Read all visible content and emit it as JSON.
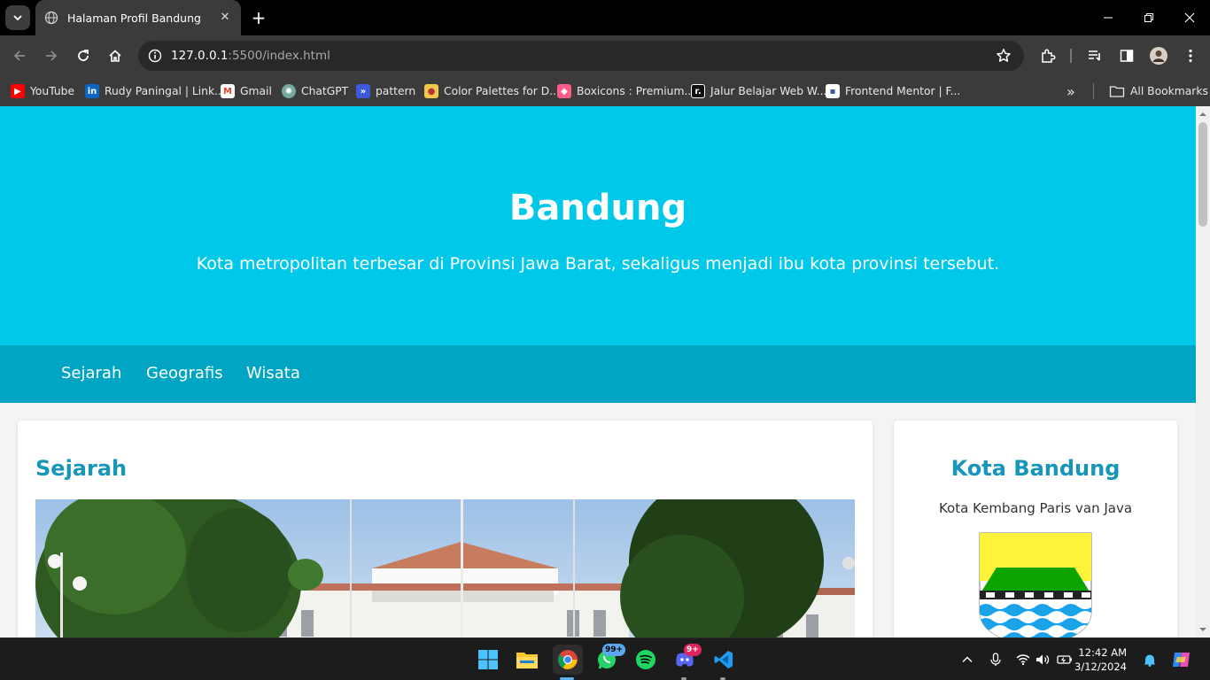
{
  "browser": {
    "tab_title": "Halaman Profil Bandung",
    "url_host": "127.0.0.1",
    "url_rest": ":5500/index.html"
  },
  "bookmarks": [
    {
      "label": "YouTube",
      "icon": "youtube-icon",
      "color": "#ff0000"
    },
    {
      "label": "Rudy Paningal | Link...",
      "icon": "linkedin-icon",
      "color": "#0a66c2"
    },
    {
      "label": "Gmail",
      "icon": "gmail-icon",
      "color": "#ea4335"
    },
    {
      "label": "ChatGPT",
      "icon": "chatgpt-icon",
      "color": "#74aa9c"
    },
    {
      "label": "pattern",
      "icon": "pattern-icon",
      "color": "#3b5bdb"
    },
    {
      "label": "Color Palettes for D...",
      "icon": "palette-icon",
      "color": "#f2c94c"
    },
    {
      "label": "Boxicons : Premium...",
      "icon": "boxicons-icon",
      "color": "#ff5c8a"
    },
    {
      "label": "Jalur Belajar Web W...",
      "icon": "dicoding-icon",
      "color": "#111111"
    },
    {
      "label": "Frontend Mentor | F...",
      "icon": "frontend-mentor-icon",
      "color": "#ffffff"
    }
  ],
  "all_bookmarks_label": "All Bookmarks",
  "page": {
    "hero_title": "Bandung",
    "hero_subtitle": "Kota metropolitan terbesar di Provinsi Jawa Barat, sekaligus menjadi ibu kota provinsi tersebut.",
    "nav": [
      "Sejarah",
      "Geografis",
      "Wisata"
    ],
    "main_heading": "Sejarah",
    "side_title": "Kota Bandung",
    "side_subtitle": "Kota Kembang Paris van Java",
    "colors": {
      "hero": "#00c8e8",
      "nav": "#00a5c4",
      "heading": "#1696b8"
    }
  },
  "taskbar": {
    "whatsapp_badge": "99+",
    "discord_badge": "9+",
    "time": "12:42 AM",
    "date": "3/12/2024"
  }
}
